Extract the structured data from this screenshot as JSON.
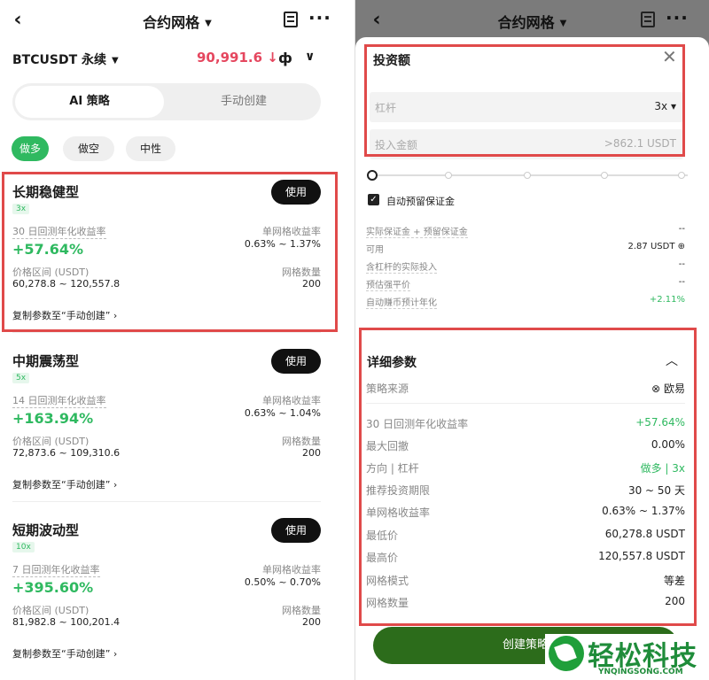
{
  "left": {
    "header": {
      "back": "‹",
      "title": "合约网格",
      "caret": "▼",
      "more": "···"
    },
    "pair": {
      "symbol": "BTCUSDT 永续",
      "caret": "▼",
      "price": "90,991.6 ↓",
      "kline_icon": "ф",
      "chevron": "∨"
    },
    "tabs": [
      "AI 策略",
      "手动创建"
    ],
    "pills": [
      "做多",
      "做空",
      "中性"
    ],
    "cards": [
      {
        "name": "长期稳健型",
        "leverage": "3x",
        "use": "使用",
        "apr_label": "30 日回测年化收益率",
        "apr": "+57.64%",
        "grid_yield_label": "单网格收益率",
        "grid_yield": "0.63% ~ 1.37%",
        "range_label": "价格区间 (USDT)",
        "range": "60,278.8 ~ 120,557.8",
        "grid_count_label": "网格数量",
        "grid_count": "200",
        "copy": "复制参数至“手动创建”  ›"
      },
      {
        "name": "中期震荡型",
        "leverage": "5x",
        "use": "使用",
        "apr_label": "14 日回测年化收益率",
        "apr": "+163.94%",
        "grid_yield_label": "单网格收益率",
        "grid_yield": "0.63% ~ 1.04%",
        "range_label": "价格区间 (USDT)",
        "range": "72,873.6 ~ 109,310.6",
        "grid_count_label": "网格数量",
        "grid_count": "200",
        "copy": "复制参数至“手动创建”  ›"
      },
      {
        "name": "短期波动型",
        "leverage": "10x",
        "use": "使用",
        "apr_label": "7 日回测年化收益率",
        "apr": "+395.60%",
        "grid_yield_label": "单网格收益率",
        "grid_yield": "0.50% ~ 0.70%",
        "range_label": "价格区间 (USDT)",
        "range": "81,982.8 ~ 100,201.4",
        "grid_count_label": "网格数量",
        "grid_count": "200",
        "copy": "复制参数至“手动创建”  ›"
      }
    ]
  },
  "right": {
    "header": {
      "back": "‹",
      "title": "合约网格",
      "caret": "▼",
      "more": "···"
    },
    "sheet": {
      "title": "投资额",
      "close": "✕",
      "leverage_label": "杠杆",
      "leverage_value": "3x ▾",
      "amount_placeholder": "投入金额",
      "amount_hint": ">862.1 USDT",
      "auto_margin": "自动预留保证金",
      "info": [
        {
          "k": "实际保证金 + 预留保证金",
          "v": "--"
        },
        {
          "k": "可用",
          "v": "2.87 USDT ⊕"
        },
        {
          "k": "含杠杆的实际投入",
          "v": "--"
        },
        {
          "k": "预估强平价",
          "v": "--"
        },
        {
          "k": "自动赚币预计年化",
          "v": "+2.11%"
        }
      ],
      "detail_title": "详细参数",
      "detail_chevron": "︿",
      "source_label": "策略来源",
      "source_value": "⊗ 欧易",
      "details": [
        {
          "k": "30 日回测年化收益率",
          "v": "+57.64%"
        },
        {
          "k": "最大回撤",
          "v": "0.00%"
        },
        {
          "k": "方向 | 杠杆",
          "v": "做多 | 3x"
        },
        {
          "k": "推荐投资期限",
          "v": "30 ~ 50 天"
        },
        {
          "k": "单网格收益率",
          "v": "0.63% ~ 1.37%"
        },
        {
          "k": "最低价",
          "v": "60,278.8 USDT"
        },
        {
          "k": "最高价",
          "v": "120,557.8 USDT"
        },
        {
          "k": "网格模式",
          "v": "等差"
        },
        {
          "k": "网格数量",
          "v": "200"
        }
      ],
      "create": "创建策略"
    },
    "watermark": {
      "text": "轻松科技",
      "sub": "YNQINGSONG.COM"
    }
  }
}
